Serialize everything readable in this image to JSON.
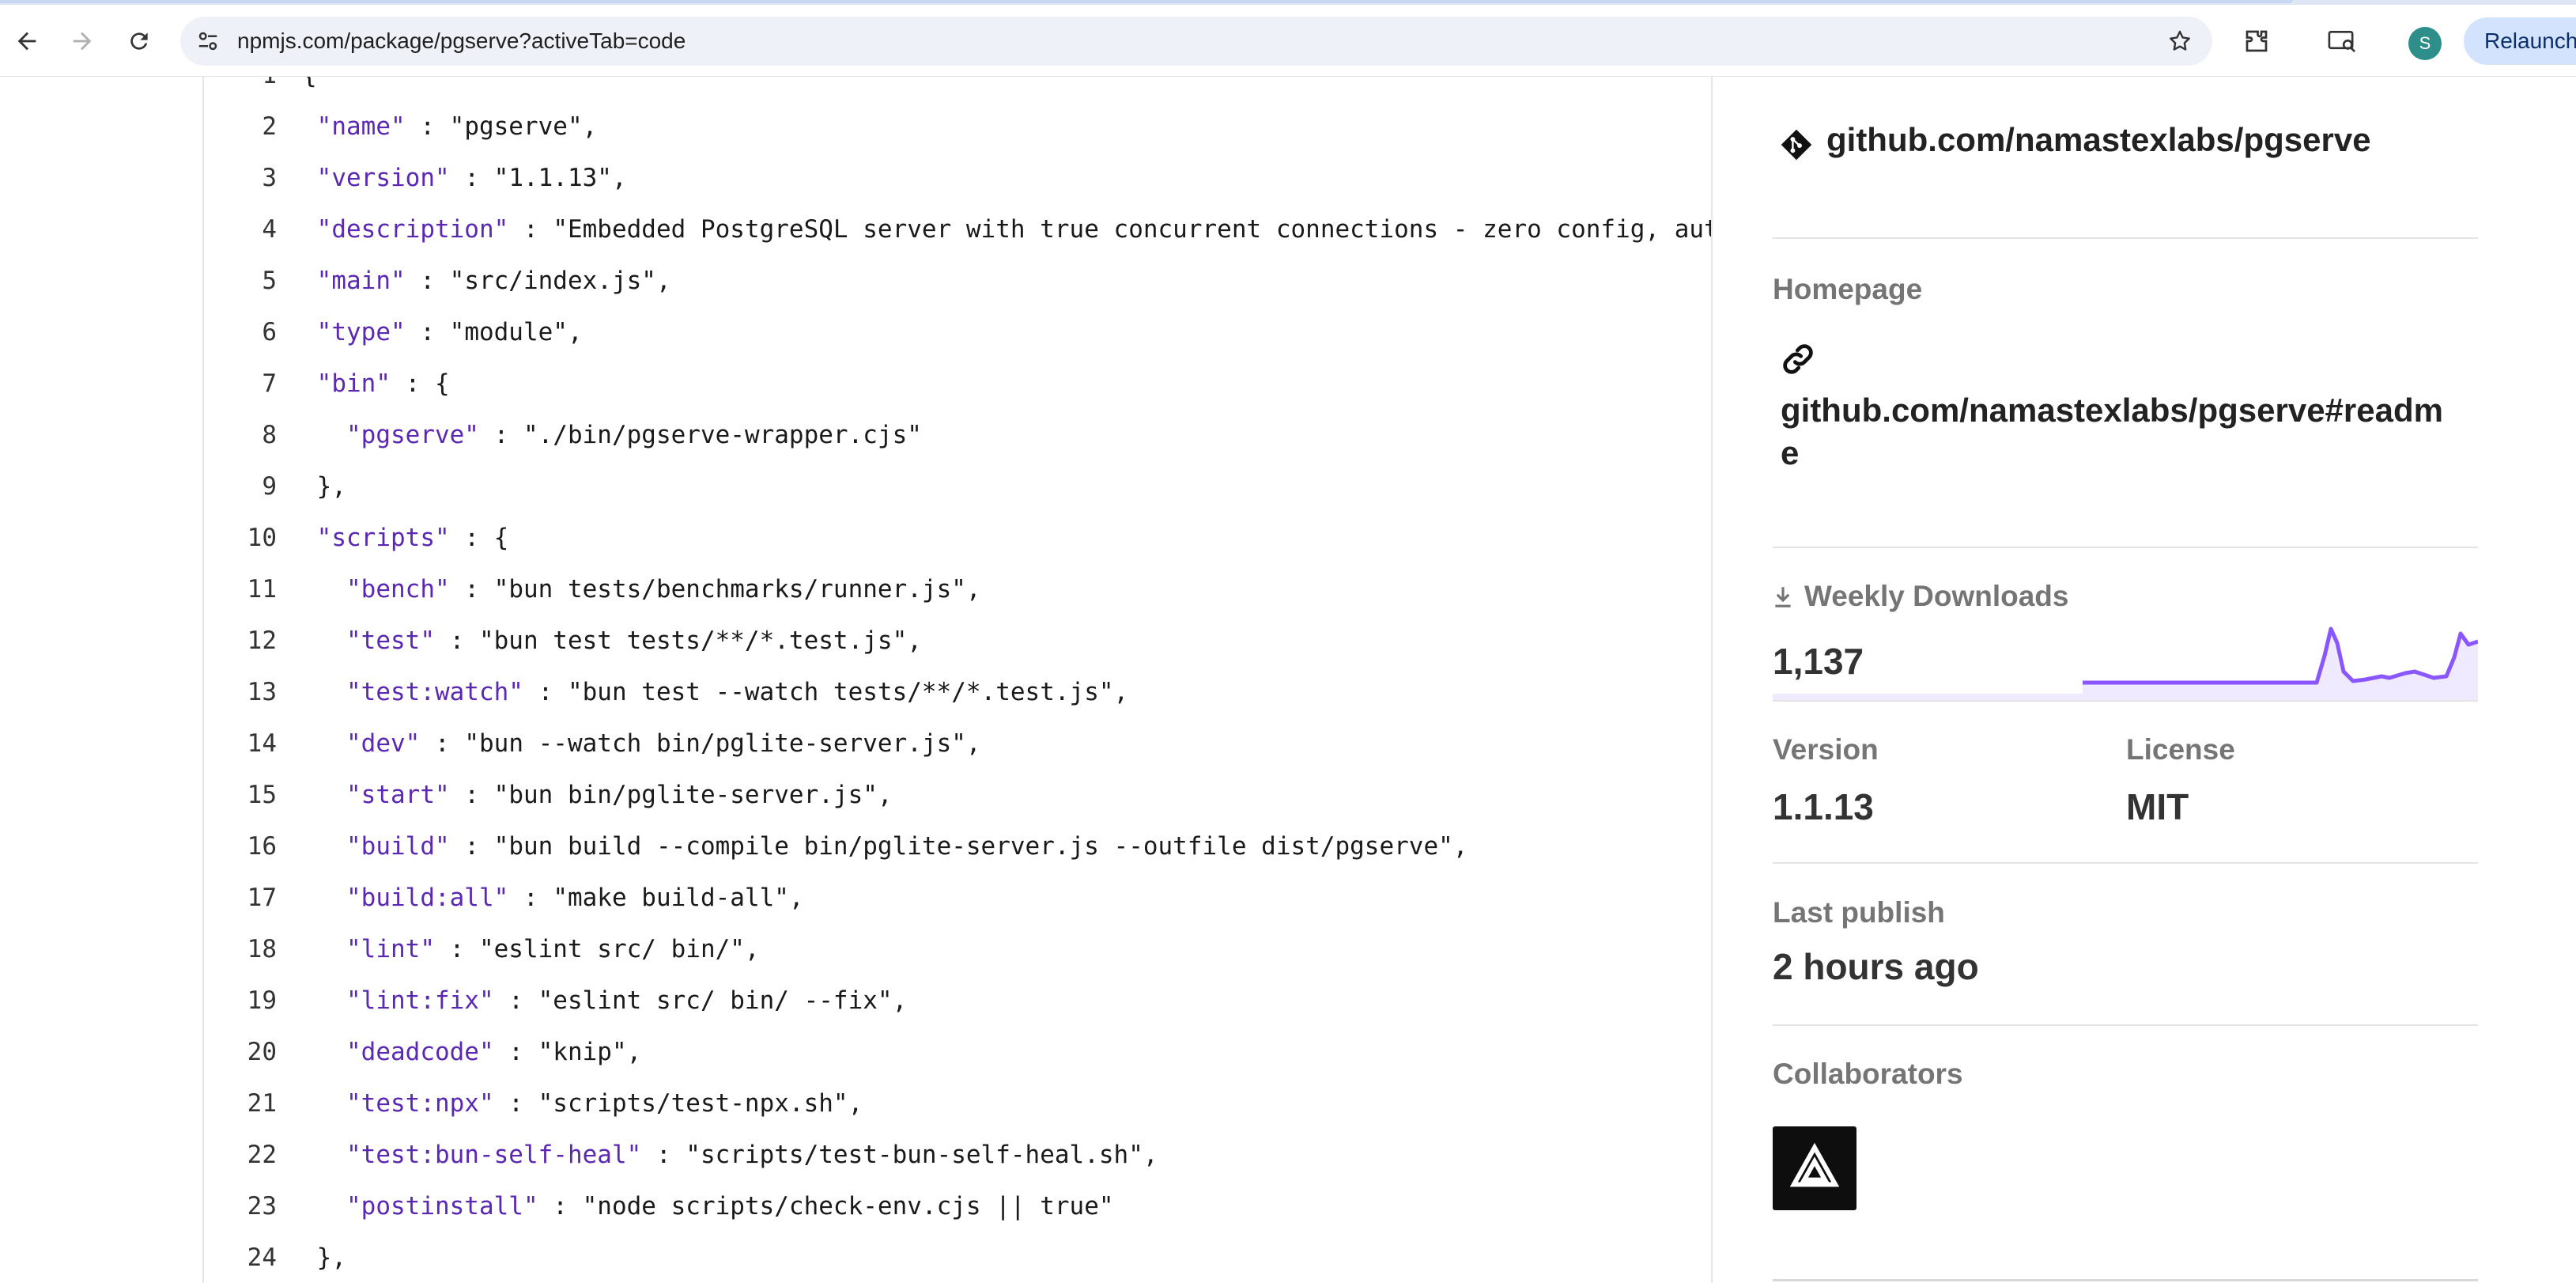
{
  "browser": {
    "url": "npmjs.com/package/pgserve?activeTab=code",
    "avatar_letter": "S",
    "relaunch_label": "Relaunch"
  },
  "code": {
    "lines": [
      {
        "n": "1",
        "indent": "",
        "key": "",
        "sep": "",
        "value": "{"
      },
      {
        "n": "2",
        "indent": " ",
        "key": "\"name\"",
        "sep": " : ",
        "value": "\"pgserve\","
      },
      {
        "n": "3",
        "indent": " ",
        "key": "\"version\"",
        "sep": " : ",
        "value": "\"1.1.13\","
      },
      {
        "n": "4",
        "indent": " ",
        "key": "\"description\"",
        "sep": " : ",
        "value": "\"Embedded PostgreSQL server with true concurrent connections - zero config, auto-"
      },
      {
        "n": "5",
        "indent": " ",
        "key": "\"main\"",
        "sep": " : ",
        "value": "\"src/index.js\","
      },
      {
        "n": "6",
        "indent": " ",
        "key": "\"type\"",
        "sep": " : ",
        "value": "\"module\","
      },
      {
        "n": "7",
        "indent": " ",
        "key": "\"bin\"",
        "sep": " : ",
        "value": "{"
      },
      {
        "n": "8",
        "indent": "   ",
        "key": "\"pgserve\"",
        "sep": " : ",
        "value": "\"./bin/pgserve-wrapper.cjs\""
      },
      {
        "n": "9",
        "indent": " ",
        "key": "",
        "sep": "",
        "value": "},"
      },
      {
        "n": "10",
        "indent": " ",
        "key": "\"scripts\"",
        "sep": " : ",
        "value": "{"
      },
      {
        "n": "11",
        "indent": "   ",
        "key": "\"bench\"",
        "sep": " : ",
        "value": "\"bun tests/benchmarks/runner.js\","
      },
      {
        "n": "12",
        "indent": "   ",
        "key": "\"test\"",
        "sep": " : ",
        "value": "\"bun test tests/**/*.test.js\","
      },
      {
        "n": "13",
        "indent": "   ",
        "key": "\"test:watch\"",
        "sep": " : ",
        "value": "\"bun test --watch tests/**/*.test.js\","
      },
      {
        "n": "14",
        "indent": "   ",
        "key": "\"dev\"",
        "sep": " : ",
        "value": "\"bun --watch bin/pglite-server.js\","
      },
      {
        "n": "15",
        "indent": "   ",
        "key": "\"start\"",
        "sep": " : ",
        "value": "\"bun bin/pglite-server.js\","
      },
      {
        "n": "16",
        "indent": "   ",
        "key": "\"build\"",
        "sep": " : ",
        "value": "\"bun build --compile bin/pglite-server.js --outfile dist/pgserve\","
      },
      {
        "n": "17",
        "indent": "   ",
        "key": "\"build:all\"",
        "sep": " : ",
        "value": "\"make build-all\","
      },
      {
        "n": "18",
        "indent": "   ",
        "key": "\"lint\"",
        "sep": " : ",
        "value": "\"eslint src/ bin/\","
      },
      {
        "n": "19",
        "indent": "   ",
        "key": "\"lint:fix\"",
        "sep": " : ",
        "value": "\"eslint src/ bin/ --fix\","
      },
      {
        "n": "20",
        "indent": "   ",
        "key": "\"deadcode\"",
        "sep": " : ",
        "value": "\"knip\","
      },
      {
        "n": "21",
        "indent": "   ",
        "key": "\"test:npx\"",
        "sep": " : ",
        "value": "\"scripts/test-npx.sh\","
      },
      {
        "n": "22",
        "indent": "   ",
        "key": "\"test:bun-self-heal\"",
        "sep": " : ",
        "value": "\"scripts/test-bun-self-heal.sh\","
      },
      {
        "n": "23",
        "indent": "   ",
        "key": "\"postinstall\"",
        "sep": " : ",
        "value": "\"node scripts/check-env.cjs || true\""
      },
      {
        "n": "24",
        "indent": " ",
        "key": "",
        "sep": "",
        "value": "},"
      }
    ]
  },
  "sidebar": {
    "repository_link": "github.com/namastexlabs/pgserve",
    "homepage_label": "Homepage",
    "homepage_link_line1": "github.com/namastexlabs/pgserve#readm",
    "homepage_link_line2": "e",
    "weekly_downloads_label": "Weekly Downloads",
    "weekly_downloads_value": "1,137",
    "version_label": "Version",
    "version_value": "1.1.13",
    "license_label": "License",
    "license_value": "MIT",
    "last_publish_label": "Last publish",
    "last_publish_value": "2 hours ago",
    "collaborators_label": "Collaborators"
  },
  "colors": {
    "accent": "#8956ff",
    "key": "#5b28b3"
  },
  "icons": {
    "back": "arrow-left-icon",
    "forward": "arrow-right-icon",
    "reload": "reload-icon",
    "site_info": "tune-icon",
    "bookmark": "star-icon",
    "extensions": "puzzle-icon",
    "cast": "cast-icon",
    "repository": "git-icon",
    "homepage": "link-icon",
    "downloads": "download-icon"
  }
}
